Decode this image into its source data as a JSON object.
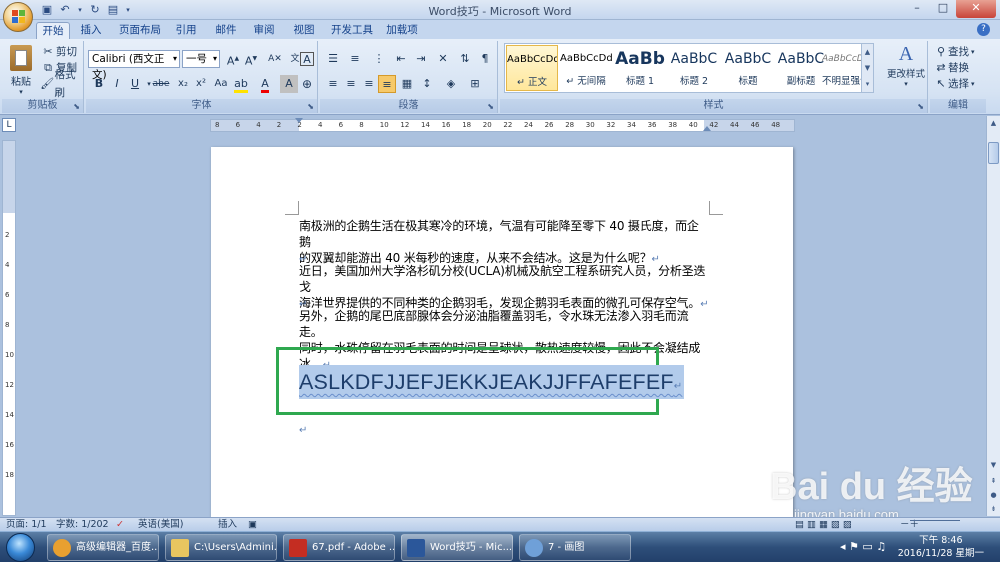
{
  "window": {
    "title": "Word技巧 - Microsoft Word",
    "controls": [
      "–",
      "□",
      "✕"
    ]
  },
  "quick_access": [
    "save-icon",
    "undo-icon",
    "redo-icon",
    "customize-icon"
  ],
  "tabs": [
    "开始",
    "插入",
    "页面布局",
    "引用",
    "邮件",
    "审阅",
    "视图",
    "开发工具",
    "加载项"
  ],
  "active_tab": "开始",
  "ribbon": {
    "clipboard": {
      "label": "剪贴板",
      "paste": "粘贴",
      "cut": "剪切",
      "copy": "复制",
      "format_painter": "格式刷"
    },
    "font": {
      "label": "字体",
      "font_name": "Calibri (西文正文)",
      "font_size": "一号",
      "buttons": [
        "B",
        "I",
        "U",
        "abe",
        "x₂",
        "x²",
        "Aa"
      ]
    },
    "paragraph": {
      "label": "段落"
    },
    "styles": {
      "label": "样式",
      "tiles": [
        {
          "preview": "AaBbCcDd",
          "name": "↵ 正文"
        },
        {
          "preview": "AaBbCcDd",
          "name": "↵ 无间隔"
        },
        {
          "preview": "AaBb",
          "name": "标题 1"
        },
        {
          "preview": "AaBbC",
          "name": "标题 2"
        },
        {
          "preview": "AaBbC",
          "name": "标题"
        },
        {
          "preview": "AaBbC",
          "name": "副标题"
        },
        {
          "preview": "AaBbCcDd",
          "name": "不明显强调"
        }
      ],
      "change_styles": "更改样式"
    },
    "editing": {
      "label": "编辑",
      "find": "查找",
      "replace": "替换",
      "select": "选择"
    }
  },
  "ruler": {
    "ticks": [
      "8",
      "6",
      "4",
      "2",
      "2",
      "4",
      "6",
      "8",
      "10",
      "12",
      "14",
      "16",
      "18",
      "20",
      "22",
      "24",
      "26",
      "28",
      "30",
      "32",
      "34",
      "36",
      "38",
      "40",
      "42",
      "44",
      "46",
      "48"
    ],
    "vticks": [
      "2",
      "4",
      "6",
      "8",
      "10",
      "12",
      "14",
      "16",
      "18"
    ]
  },
  "document": {
    "paragraphs": [
      {
        "line1": "南极洲的企鹅生活在极其寒冷的环境，气温有可能降至零下 40 摄氏度，而企鹅",
        "line2": "的双翼却能游出 40 米每秒的速度，从来不会结冰。这是为什么呢？"
      },
      {
        "line1": "近日，美国加州大学洛杉矶分校(UCLA)机械及航空工程系研究人员，分析圣迭戈",
        "line2": "海洋世界提供的不同种类的企鹅羽毛，发现企鹅羽毛表面的微孔可保存空气。"
      },
      {
        "line1": "另外，企鹅的尾巴底部腺体会分泌油脂覆盖羽毛，令水珠无法渗入羽毛而流走。",
        "line2": "同时，水珠停留在羽毛表面的时间是呈球状，散热速度较慢，因此不会凝结成冰。"
      }
    ],
    "paragraph_mark": "↵",
    "selected_text": "ASLKDFJJEFJEKKJEAKJJFFAFEFEF"
  },
  "status": {
    "page": "页面: 1/1",
    "words": "字数: 1/202",
    "language": "英语(美国)",
    "mode": "插入"
  },
  "watermark": {
    "logo": "Bai du 经验",
    "url": "jingyan.baidu.com"
  },
  "taskbar": {
    "items": [
      {
        "label": "高级编辑器_百度...",
        "color": "#e8a030"
      },
      {
        "label": "C:\\Users\\Admini...",
        "color": "#e8c560"
      },
      {
        "label": "67.pdf - Adobe ...",
        "color": "#c42d22"
      },
      {
        "label": "Word技巧 - Mic...",
        "color": "#2b579a"
      },
      {
        "label": "7 - 画图",
        "color": "#6fa0d8"
      }
    ],
    "time": "下午 8:46",
    "date": "2016/11/28 星期一"
  },
  "colors": {
    "selection_box": "#2fa84f",
    "selection_highlight": "#b2cbeb",
    "ribbon_bg": "#dbe6f4"
  }
}
